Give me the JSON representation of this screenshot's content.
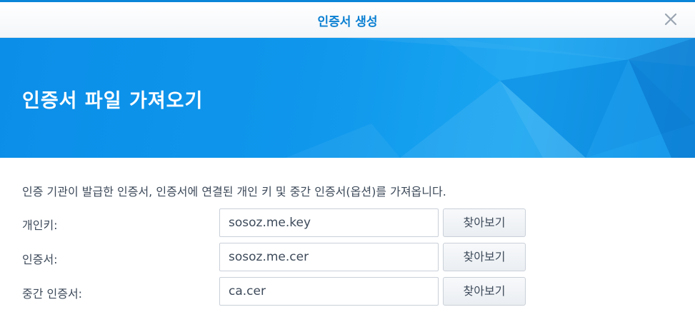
{
  "dialog": {
    "title": "인증서 생성",
    "close_icon": "close-icon"
  },
  "banner": {
    "heading": "인증서 파일 가져오기"
  },
  "content": {
    "description": "인증 기관이 발급한 인증서, 인증서에 연결된 개인 키 및 중간 인증서(옵션)를 가져옵니다.",
    "rows": [
      {
        "label": "개인키:",
        "value": "sosoz.me.key",
        "browse_label": "찾아보기"
      },
      {
        "label": "인증서:",
        "value": "sosoz.me.cer",
        "browse_label": "찾아보기"
      },
      {
        "label": "중간 인증서:",
        "value": "ca.cer",
        "browse_label": "찾아보기"
      }
    ]
  },
  "colors": {
    "accent": "#0a86d8",
    "title_text": "#0a7fd2",
    "banner_blue": "#0f97ec",
    "body_text": "#3d4a5a"
  }
}
